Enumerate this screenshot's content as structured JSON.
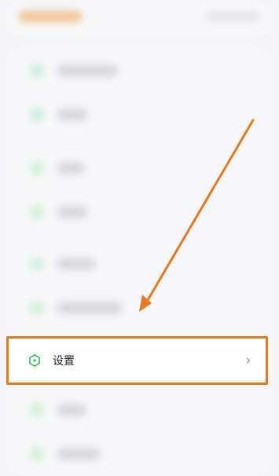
{
  "settings_row": {
    "label": "设置"
  },
  "colors": {
    "highlight": "#e47a21",
    "icon_green": "#2dbb4b",
    "background": "#f3f4f6"
  },
  "icons": {
    "settings": "hexagon-settings-icon",
    "chevron": "chevron-right-icon"
  }
}
